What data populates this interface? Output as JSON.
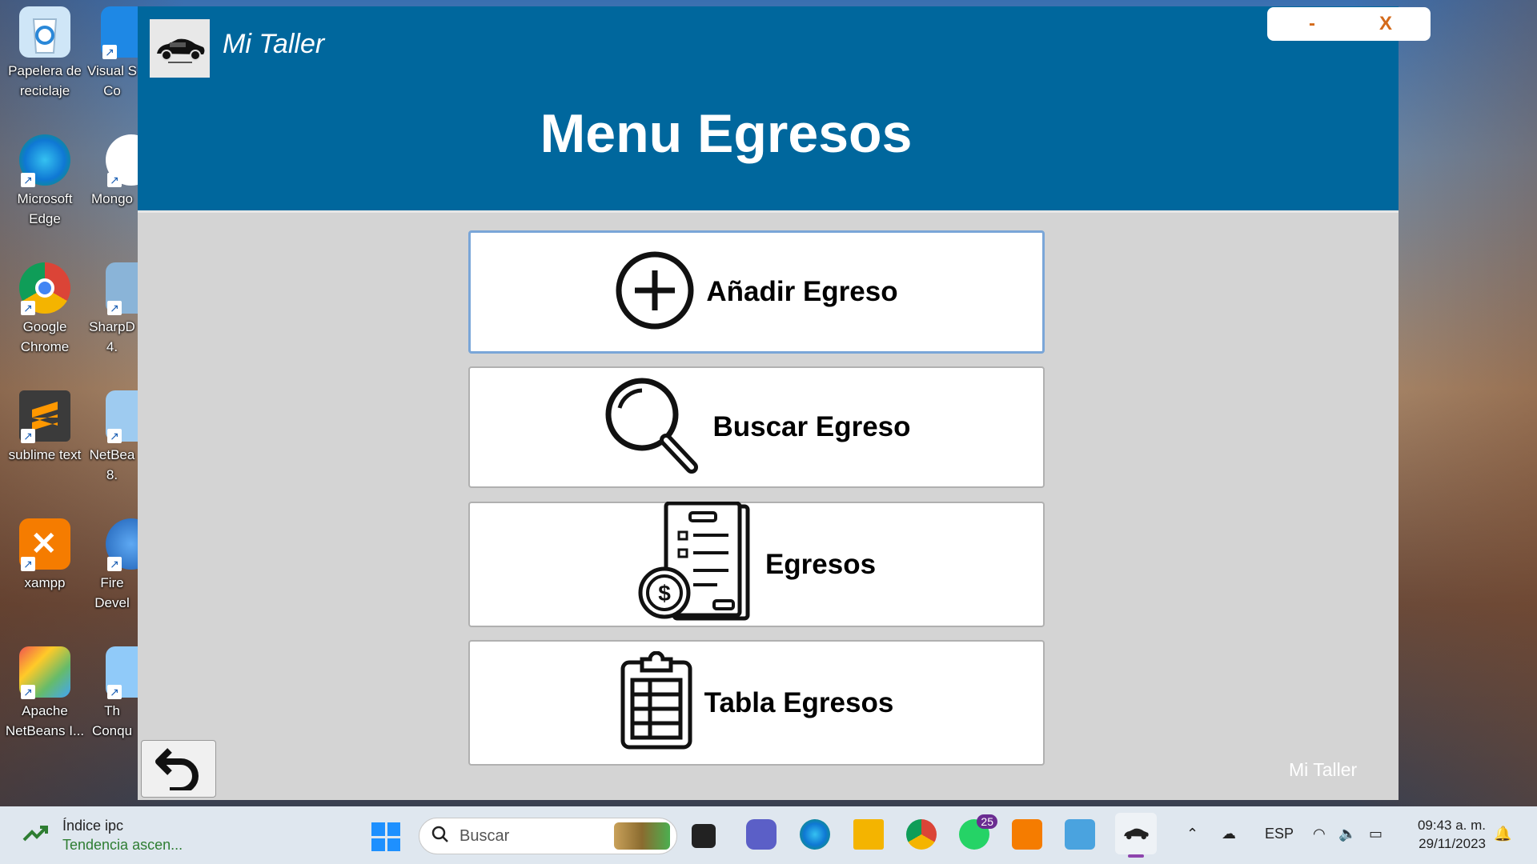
{
  "desktop": {
    "icons": [
      {
        "label": "Papelera de reciclaje",
        "icon": "recycle-bin-icon",
        "color": "#4aa3df"
      },
      {
        "label": "Visual S Co",
        "icon": "vscode-icon",
        "color": "#1e88e5"
      },
      {
        "label": "Microsoft Edge",
        "icon": "edge-icon",
        "color": "#0f9d58"
      },
      {
        "label": "Mongo",
        "icon": "mongodb-icon",
        "color": "#3d9a3d"
      },
      {
        "label": "Google Chrome",
        "icon": "chrome-icon",
        "color": "#db4437"
      },
      {
        "label": "SharpD 4.",
        "icon": "sharpdevelop-icon",
        "color": "#8ab4d8"
      },
      {
        "label": "sublime text",
        "icon": "sublime-icon",
        "color": "#ff9800"
      },
      {
        "label": "NetBea 8.",
        "icon": "netbeans-icon",
        "color": "#9ecbf0"
      },
      {
        "label": "xampp",
        "icon": "xampp-icon",
        "color": "#f57c00"
      },
      {
        "label": "Fire Devel",
        "icon": "firefox-dev-icon",
        "color": "#1e88e5"
      },
      {
        "label": "Apache NetBeans I...",
        "icon": "apache-netbeans-icon",
        "color": "#66bb6a"
      },
      {
        "label": "Th Conqu",
        "icon": "conqueror-icon",
        "color": "#90caf9"
      }
    ]
  },
  "app": {
    "name": "Mi Taller",
    "minimize_label": "-",
    "close_label": "X",
    "title": "Menu Egresos",
    "buttons": [
      {
        "label": "Añadir Egreso",
        "icon": "plus-circle-icon"
      },
      {
        "label": "Buscar Egreso",
        "icon": "magnifier-icon"
      },
      {
        "label": "Egresos",
        "icon": "expense-report-icon"
      },
      {
        "label": "Tabla Egresos",
        "icon": "clipboard-table-icon"
      }
    ],
    "back_icon": "undo-arrow-icon",
    "footer_name": "Mi Taller",
    "colors": {
      "header": "#00679d",
      "body": "#d4d4d4",
      "window_button_text": "#d46a1a"
    }
  },
  "taskbar": {
    "widget_title": "Índice ipc",
    "widget_subtitle": "Tendencia ascen...",
    "search_placeholder": "Buscar",
    "whatsapp_badge": "25",
    "language": "ESP",
    "time": "09:43 a. m.",
    "date": "29/11/2023"
  }
}
